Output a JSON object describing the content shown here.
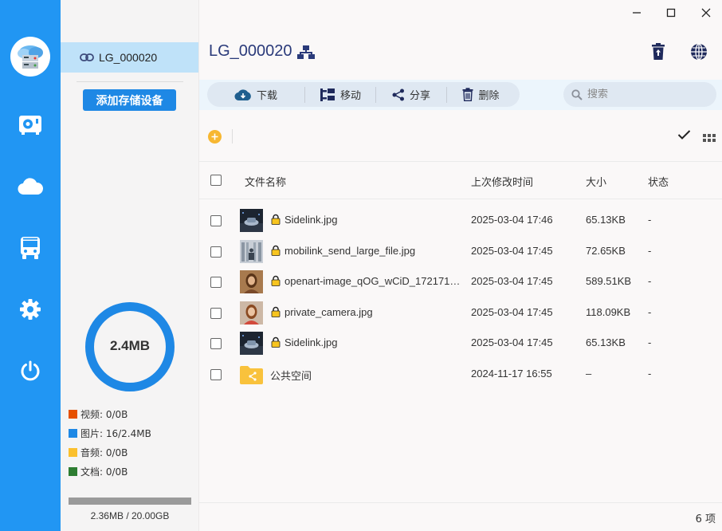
{
  "window": {
    "minimize_icon": "minimize-icon",
    "maximize_icon": "maximize-icon",
    "close_icon": "close-icon"
  },
  "rail": {
    "items": [
      {
        "icon": "storage-drive-icon"
      },
      {
        "icon": "cloud-icon"
      },
      {
        "icon": "bus-icon"
      },
      {
        "icon": "gear-icon"
      },
      {
        "icon": "power-icon"
      }
    ]
  },
  "devices": {
    "selected": {
      "label": "LG_000020",
      "icon": "link-icon"
    },
    "add_button": "添加存储设备"
  },
  "usage": {
    "total_label": "2.4MB",
    "legend": [
      {
        "label": "视频: 0/0B",
        "color": "#e65100"
      },
      {
        "label": "图片: 16/2.4MB",
        "color": "#1e88e5"
      },
      {
        "label": "音频: 0/0B",
        "color": "#fbc02d"
      },
      {
        "label": "文档: 0/0B",
        "color": "#2e7d32"
      }
    ],
    "storage_text": "2.36MB / 20.00GB",
    "storage_fraction": 0.000118
  },
  "header": {
    "title": "LG_000020",
    "title_icon": "network-icon",
    "trash_icon": "recycle-bin-icon",
    "globe_icon": "globe-icon"
  },
  "toolbar": {
    "download": "下载",
    "move": "移动",
    "share": "分享",
    "delete": "删除"
  },
  "search": {
    "placeholder": "搜索"
  },
  "columns": {
    "name": "文件名称",
    "modified": "上次修改时间",
    "size": "大小",
    "status": "状态"
  },
  "files": [
    {
      "name": "Sidelink.jpg",
      "modified": "2025-03-04 17:46",
      "size": "65.13KB",
      "status": "-",
      "locked": true,
      "thumb": "dark-car"
    },
    {
      "name": "mobilink_send_large_file.jpg",
      "modified": "2025-03-04 17:45",
      "size": "72.65KB",
      "status": "-",
      "locked": true,
      "thumb": "office"
    },
    {
      "name": "openart-image_qOG_wCiD_172171…",
      "modified": "2025-03-04 17:45",
      "size": "589.51KB",
      "status": "-",
      "locked": true,
      "thumb": "portrait"
    },
    {
      "name": "private_camera.jpg",
      "modified": "2025-03-04 17:45",
      "size": "118.09KB",
      "status": "-",
      "locked": true,
      "thumb": "portrait2"
    },
    {
      "name": "Sidelink.jpg",
      "modified": "2025-03-04 17:45",
      "size": "65.13KB",
      "status": "-",
      "locked": true,
      "thumb": "dark-car"
    },
    {
      "name": "公共空间",
      "modified": "2024-11-17 16:55",
      "size": "–",
      "status": "-",
      "locked": false,
      "thumb": "shared-folder"
    }
  ],
  "footer": {
    "count": "6 项"
  }
}
